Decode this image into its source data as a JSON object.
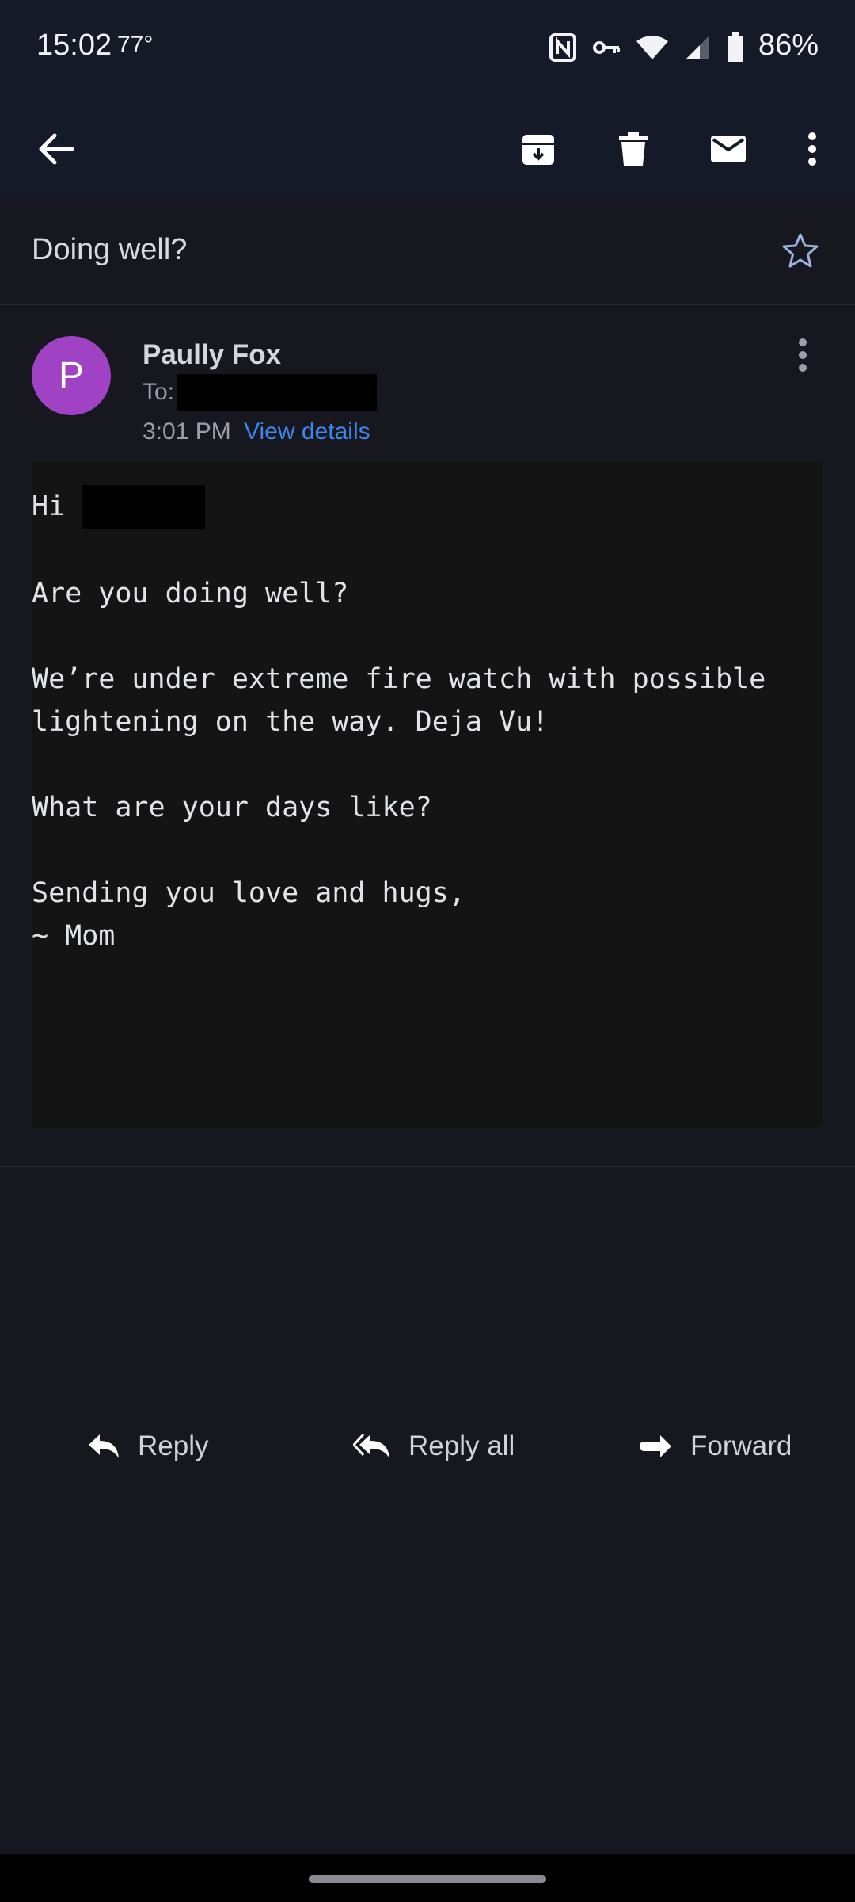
{
  "status_bar": {
    "time": "15:02",
    "temperature": "77°",
    "battery_percent": "86%",
    "icons": [
      "nfc-icon",
      "vpn-key-icon",
      "wifi-icon",
      "signal-icon",
      "battery-icon"
    ]
  },
  "toolbar": {
    "icons": [
      "back-arrow-icon",
      "archive-icon",
      "delete-icon",
      "mark-unread-icon",
      "more-vert-icon"
    ]
  },
  "email": {
    "subject": "Doing well?",
    "sender_initial": "P",
    "sender_name": "Paully Fox",
    "to_label": "To:",
    "time": "3:01 PM",
    "view_details": "View details",
    "body": {
      "greeting": "Hi",
      "lines": [
        "Are you doing well?",
        "We’re under extreme fire watch with possible",
        "lightening on the way. Deja Vu!",
        "What are your days like?",
        "Sending you love and hugs,",
        "~ Mom"
      ]
    }
  },
  "actions": {
    "reply": "Reply",
    "reply_all": "Reply all",
    "forward": "Forward"
  },
  "colors": {
    "background": "#17181f",
    "header": "#141a27",
    "avatar": "#a042c4",
    "link": "#3d86ea"
  }
}
